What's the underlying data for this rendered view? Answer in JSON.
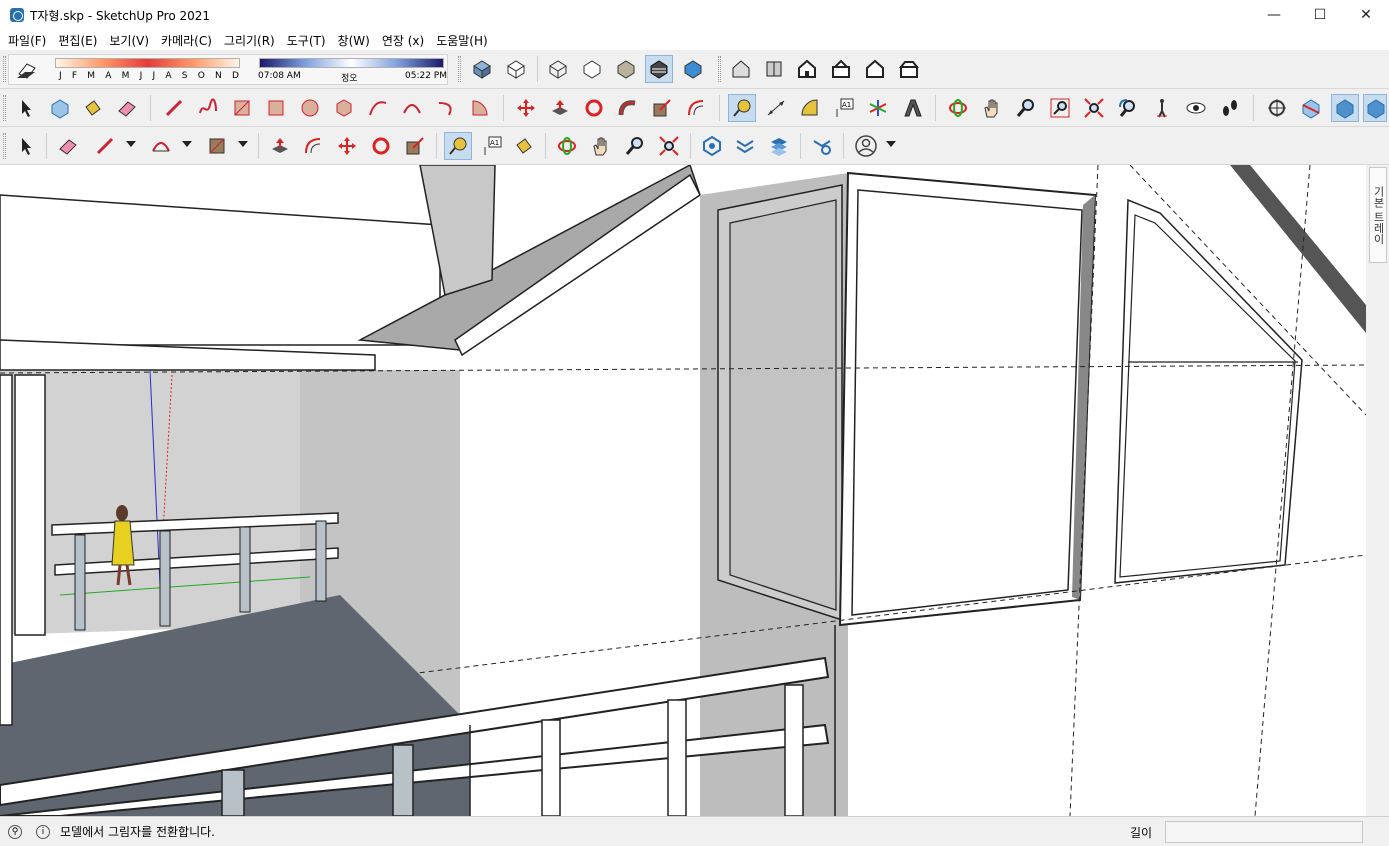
{
  "window": {
    "title": "T자형.skp - SketchUp Pro 2021",
    "minimize": "—",
    "maximize": "☐",
    "close": "✕"
  },
  "menu": [
    "파일(F)",
    "편집(E)",
    "보기(V)",
    "카메라(C)",
    "그리기(R)",
    "도구(T)",
    "창(W)",
    "연장 (x)",
    "도움말(H)"
  ],
  "shadow": {
    "months": [
      "J",
      "F",
      "M",
      "A",
      "M",
      "J",
      "J",
      "A",
      "S",
      "O",
      "N",
      "D"
    ],
    "time_start": "07:08 AM",
    "time_noon": "정오",
    "time_end": "05:22 PM"
  },
  "tray": {
    "tab_label": "기본 트레이"
  },
  "status": {
    "message": "모델에서 그림자를 전환합니다.",
    "measure_label": "길이",
    "measure_value": ""
  },
  "colors": {
    "accent": "#c8dcf0",
    "floor": "#5f6670",
    "wall": "#c6c6c6"
  }
}
